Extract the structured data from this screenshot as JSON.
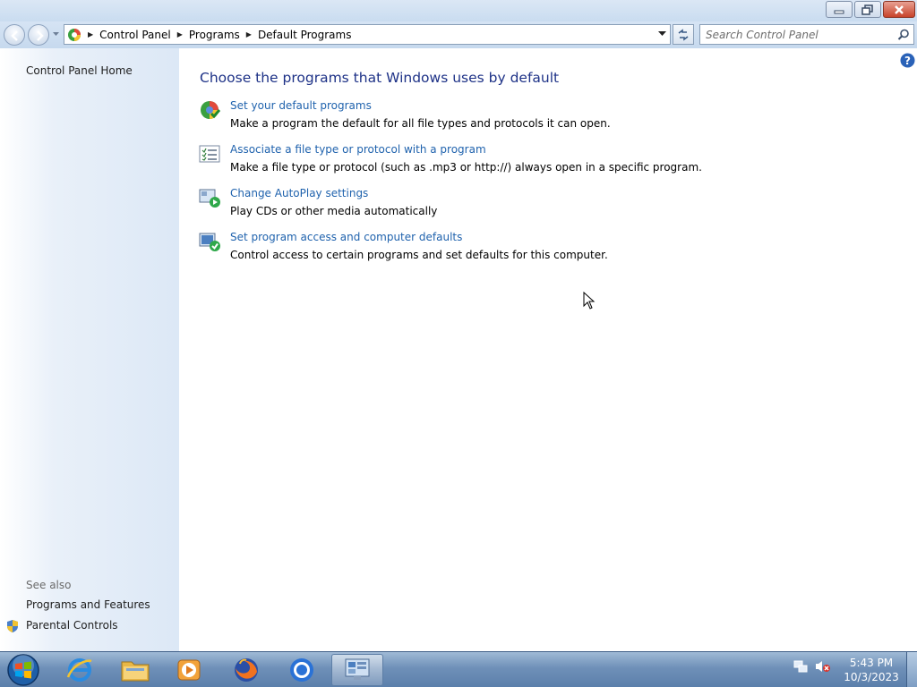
{
  "window": {
    "breadcrumb": [
      "Control Panel",
      "Programs",
      "Default Programs"
    ],
    "search_placeholder": "Search Control Panel"
  },
  "sidebar": {
    "home": "Control Panel Home",
    "see_also_label": "See also",
    "see_also_links": [
      "Programs and Features",
      "Parental Controls"
    ]
  },
  "main": {
    "title": "Choose the programs that Windows uses by default",
    "tasks": [
      {
        "icon": "default-programs-icon",
        "link": "Set your default programs",
        "description": "Make a program the default for all file types and protocols it can open."
      },
      {
        "icon": "file-association-icon",
        "link": "Associate a file type or protocol with a program",
        "description": "Make a file type or protocol (such as .mp3 or http://) always open in a specific program."
      },
      {
        "icon": "autoplay-icon",
        "link": "Change AutoPlay settings",
        "description": "Play CDs or other media automatically"
      },
      {
        "icon": "program-access-icon",
        "link": "Set program access and computer defaults",
        "description": "Control access to certain programs and set defaults for this computer."
      }
    ]
  },
  "taskbar": {
    "apps": [
      "start-orb",
      "internet-explorer-icon",
      "file-explorer-icon",
      "media-player-icon",
      "firefox-icon",
      "chrome-icon",
      "control-panel-icon"
    ],
    "time": "5:43 PM",
    "date": "10/3/2023"
  },
  "colors": {
    "link": "#1f62ad",
    "title": "#1e3287",
    "sidebar_bg": "#dce8f6",
    "taskbar_bg": "#6f90b8"
  }
}
